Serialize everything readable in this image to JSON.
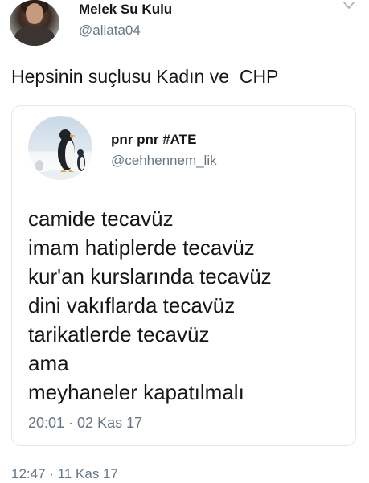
{
  "tweet": {
    "author": {
      "name": "Melek Su Kulu",
      "handle": "@aliata04"
    },
    "text": "Hepsinin suçlusu Kadın ve  CHP",
    "timestamp": "12:47 · 11 Kas 17",
    "menu_icon": "chevron-down-icon"
  },
  "quoted_tweet": {
    "author": {
      "name": "pnr pnr #ATE",
      "handle": "@cehhennem_lik"
    },
    "lines": [
      "camide tecavüz",
      "imam hatiplerde tecavüz",
      "kur'an kurslarında tecavüz",
      "dini vakıflarda tecavüz",
      "tarikatlerde tecavüz",
      "ama",
      "meyhaneler kapatılmalı"
    ],
    "timestamp": "20:01 · 02 Kas 17"
  },
  "colors": {
    "text": "#14171a",
    "secondary": "#657786",
    "border": "#e1e8ed",
    "background": "#ffffff"
  }
}
